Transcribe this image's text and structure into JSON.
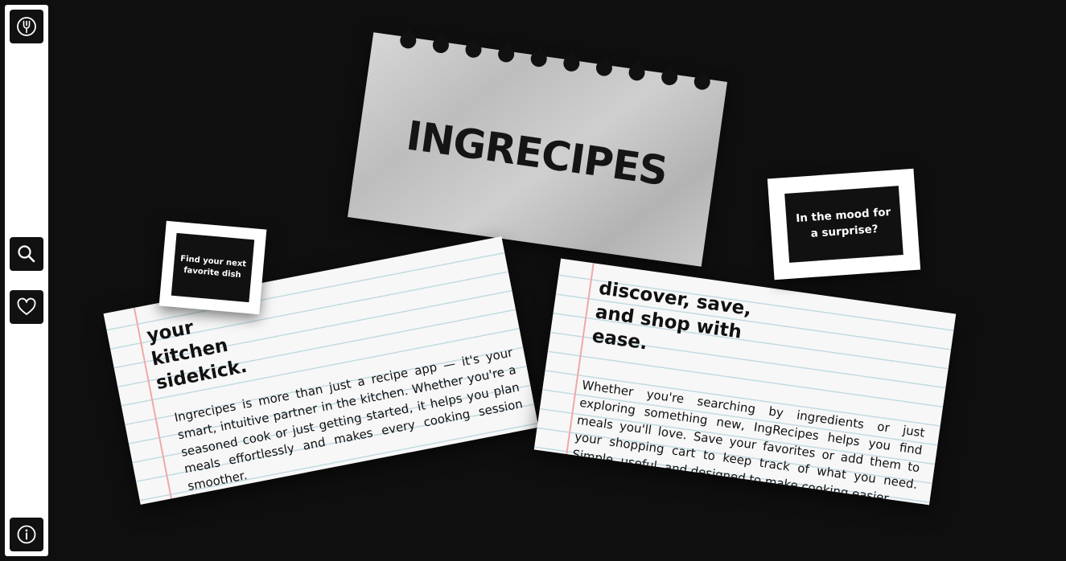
{
  "sidebar": {
    "items": [
      {
        "icon": "fork-logo-icon",
        "label": "Home"
      },
      {
        "icon": "search-icon",
        "label": "Search"
      },
      {
        "icon": "heart-icon",
        "label": "Favorites"
      },
      {
        "icon": "info-icon",
        "label": "Info"
      }
    ]
  },
  "hero": {
    "title": "INGRECIPES"
  },
  "card_left": {
    "sticker": "Find your next favorite dish",
    "heading_lines": [
      "your",
      "kitchen",
      "sidekick."
    ],
    "body": "Ingrecipes is more than just a recipe app — it's your smart, intuitive partner in the kitchen. Whether you're a seasoned cook or just getting started, it helps you plan meals effortlessly and makes every cooking session smoother."
  },
  "card_right": {
    "sticker": "In the mood for a surprise?",
    "heading_lines": [
      "discover, save,",
      "and shop with",
      "ease."
    ],
    "body": "Whether you're searching by ingredients or just exploring something new, IngRecipes helps you find meals you'll love. Save your favorites or add them to your shopping cart to keep track of what you need. Simple, useful, and designed to make cooking easier."
  },
  "colors": {
    "background": "#0f0f0f",
    "sidebar": "#ffffff",
    "button": "#111111",
    "paper": "#f7f7f7",
    "ruled_line": "#c3dbe3",
    "margin_line": "#f0a8a8"
  }
}
